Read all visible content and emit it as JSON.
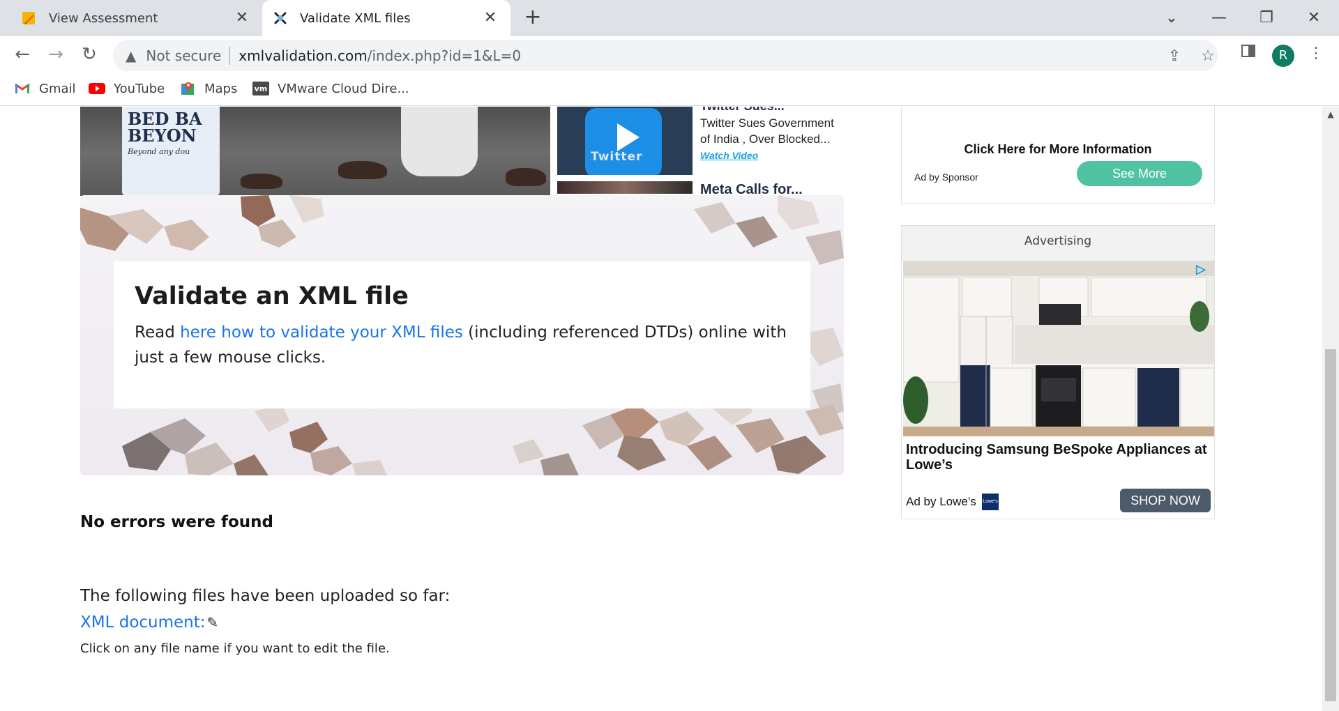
{
  "browser": {
    "tabs": [
      {
        "title": "View Assessment",
        "icon": "pencil-note-icon",
        "active": false
      },
      {
        "title": "Validate XML files",
        "icon": "xml-validation-favicon",
        "active": true
      }
    ],
    "omnibox": {
      "security_label": "Not secure",
      "url_domain": "xmlvalidation.com",
      "url_path": "/index.php?id=1&L=0"
    },
    "profile_initial": "R",
    "bookmarks": [
      {
        "label": "Gmail",
        "icon": "gmail-icon"
      },
      {
        "label": "YouTube",
        "icon": "youtube-icon"
      },
      {
        "label": "Maps",
        "icon": "maps-icon"
      },
      {
        "label": "VMware Cloud Dire...",
        "icon": "vmware-icon"
      }
    ]
  },
  "news": {
    "bag_line1": "BED BA",
    "bag_line2": "BEYON",
    "bag_tagline": "Beyond any dou",
    "twitter_thumb_label": "Twitter",
    "story1_title": "Twitter Sues...",
    "story1_desc": "Twitter Sues Government of India , Over Blocked...",
    "story1_watch": "Watch Video",
    "story2_title": "Meta Calls for..."
  },
  "hero": {
    "title": "Validate an XML file",
    "text_before": "Read ",
    "link_text": "here how to validate your XML files",
    "text_after": " (including referenced DTDs) online with just a few mouse clicks."
  },
  "result": {
    "status": "No errors were found",
    "uploaded_label": "The following files have been uploaded so far:",
    "file_link": "XML document:",
    "hint": "Click on any file name if you want to edit the file."
  },
  "ads": {
    "top": {
      "headline": "Click Here for More Information",
      "sponsor": "Ad by Sponsor",
      "button": "See More"
    },
    "lowes": {
      "header": "Advertising",
      "title": "Introducing Samsung BeSpoke Appliances at Lowe’s",
      "sponsor": "Ad by Lowe’s",
      "logo_text": "Lowe's",
      "button": "SHOP NOW"
    }
  },
  "colors": {
    "link": "#1a73e8",
    "see_more_button": "#4fc3a1",
    "shop_now_button": "#4c5a6a",
    "tab_strip": "#dee1e6"
  }
}
